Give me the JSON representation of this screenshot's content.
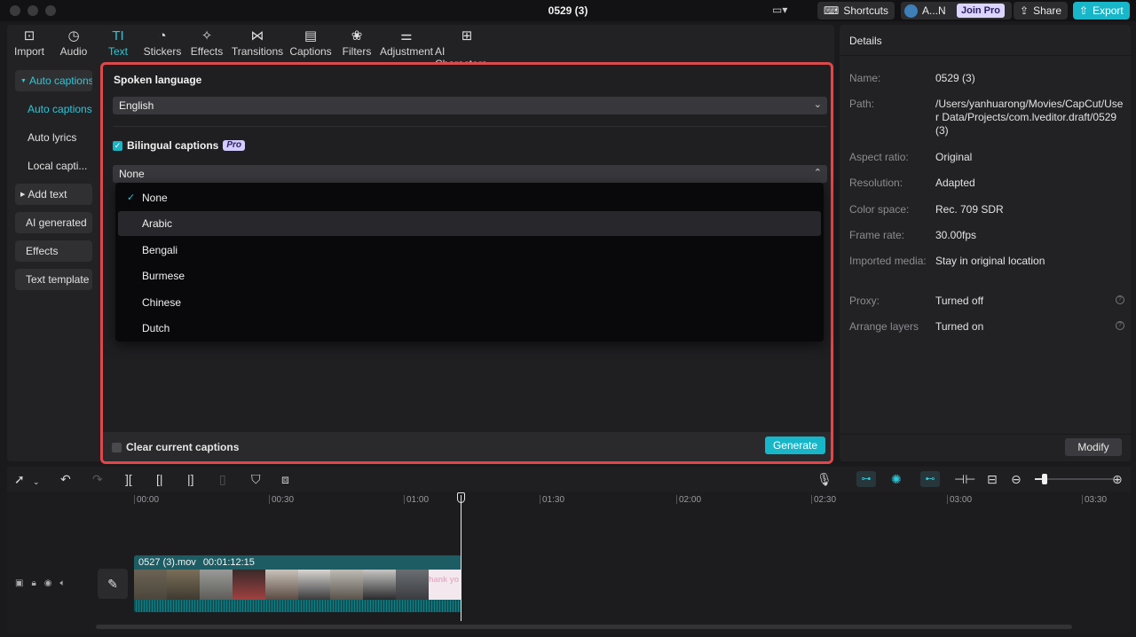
{
  "window": {
    "title": "0529 (3)",
    "shortcuts_label": "Shortcuts",
    "account_label": "A...N",
    "join_pro_label": "Join Pro",
    "share_label": "Share",
    "export_label": "Export"
  },
  "toptabs": [
    {
      "label": "Import",
      "icon": "import-icon",
      "glyph": "⊡"
    },
    {
      "label": "Audio",
      "icon": "audio-icon",
      "glyph": "◷"
    },
    {
      "label": "Text",
      "icon": "text-icon",
      "glyph": "TI",
      "active": true
    },
    {
      "label": "Stickers",
      "icon": "stickers-icon",
      "glyph": "◔"
    },
    {
      "label": "Effects",
      "icon": "effects-icon",
      "glyph": "✧"
    },
    {
      "label": "Transitions",
      "icon": "transitions-icon",
      "glyph": "⋈"
    },
    {
      "label": "Captions",
      "icon": "captions-icon",
      "glyph": "▤"
    },
    {
      "label": "Filters",
      "icon": "filters-icon",
      "glyph": "❀"
    },
    {
      "label": "Adjustment",
      "icon": "adjustment-icon",
      "glyph": "⚌"
    },
    {
      "label": "AI Characters",
      "icon": "ai-characters-icon",
      "glyph": "⊞"
    }
  ],
  "nav": {
    "auto_captions_group": "Auto captions",
    "auto_captions": "Auto captions",
    "auto_lyrics": "Auto lyrics",
    "local_captions": "Local capti...",
    "add_text": "Add text",
    "ai_generated": "AI generated",
    "effects": "Effects",
    "text_template": "Text template"
  },
  "captions": {
    "spoken_language_label": "Spoken language",
    "spoken_language_value": "English",
    "bilingual_label": "Bilingual captions",
    "pro_badge": "Pro",
    "bilingual_value": "None",
    "options": [
      "None",
      "Arabic",
      "Bengali",
      "Burmese",
      "Chinese",
      "Dutch"
    ],
    "selected_option": "None",
    "hovered_option": "Arabic",
    "clear_label": "Clear current captions",
    "generate_label": "Generate"
  },
  "details": {
    "title": "Details",
    "rows": [
      {
        "key": "Name:",
        "value": "0529 (3)"
      },
      {
        "key": "Path:",
        "value": "/Users/yanhuarong/Movies/CapCut/User Data/Projects/com.lveditor.draft/0529 (3)"
      },
      {
        "key": "Aspect ratio:",
        "value": "Original"
      },
      {
        "key": "Resolution:",
        "value": "Adapted"
      },
      {
        "key": "Color space:",
        "value": "Rec. 709 SDR"
      },
      {
        "key": "Frame rate:",
        "value": "30.00fps"
      },
      {
        "key": "Imported media:",
        "value": "Stay in original location"
      },
      {
        "key": "Proxy:",
        "value": "Turned off"
      },
      {
        "key": "Arrange layers",
        "value": "Turned on"
      }
    ],
    "modify_label": "Modify"
  },
  "timeline": {
    "ruler": [
      "00:00",
      "00:30",
      "01:00",
      "01:30",
      "02:00",
      "02:30",
      "03:00",
      "03:30"
    ],
    "clip_name": "0527 (3).mov",
    "clip_duration": "00:01:12:15",
    "thumbnail_text": "hank yo"
  },
  "colors": {
    "accent": "#2bc8d8",
    "highlight_border": "#e0474a",
    "generate": "#17b6c8"
  }
}
